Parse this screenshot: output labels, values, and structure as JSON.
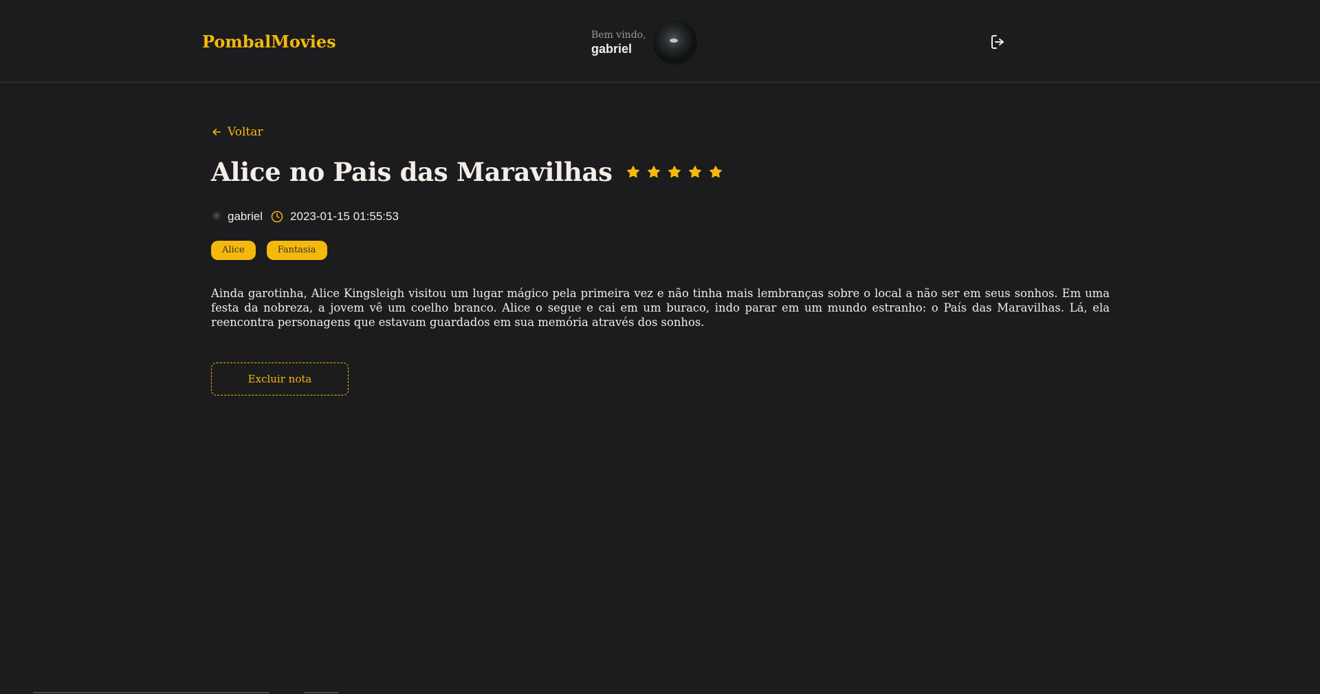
{
  "header": {
    "brand": "PombalMovies",
    "welcome": "Bem vindo,",
    "user_name": "gabriel",
    "logout_icon": "sign-out-icon"
  },
  "note": {
    "back_label": "Voltar",
    "title": "Alice no Pais das Maravilhas",
    "rating": 5,
    "rating_max": 5,
    "author": "gabriel",
    "datetime": "2023-01-15 01:55:53",
    "tags": [
      "Alice",
      "Fantasia"
    ],
    "description": "Ainda garotinha, Alice Kingsleigh visitou um lugar mágico pela primeira vez e não tinha mais lembranças sobre o local a não ser em seus sonhos. Em uma festa da nobreza, a jovem vê um coelho branco. Alice o segue e cai em um buraco, indo parar em um mundo estranho: o País das Maravilhas. Lá, ela reencontra personagens que estavam guardados em sua memória através dos sonhos.",
    "delete_label": "Excluir nota"
  },
  "colors": {
    "background": "#1c1c1e",
    "accent": "#f5b90b",
    "text": "#f4ede8",
    "muted": "#9a9a9a",
    "tag_text": "#312e38"
  }
}
